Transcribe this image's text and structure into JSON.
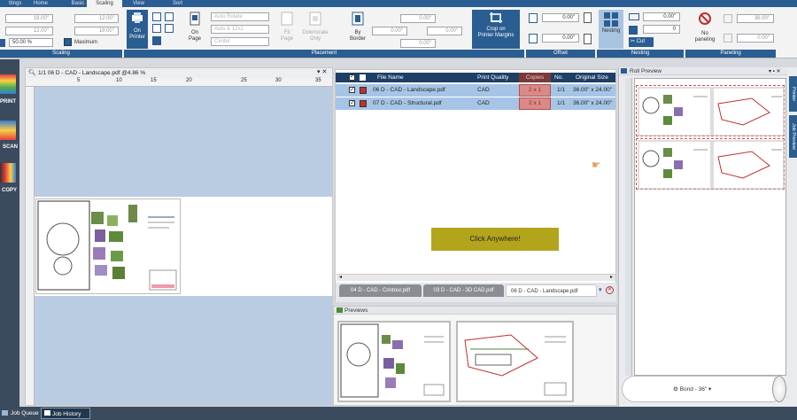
{
  "ribbon_tabs": [
    "ttings",
    "Home",
    "Basic",
    "Scaling",
    "View",
    "Sort"
  ],
  "scaling": {
    "spin1": "18.00\"",
    "spin2": "12.00\"",
    "spin3": "12.00\"",
    "spin4": "18.00\"",
    "percent": "50.00 %",
    "maximum_label": "Maximum",
    "group_title": "Scaling"
  },
  "placement": {
    "on_printer": "On\nPrinter",
    "on_page": "On\nPage",
    "fit_page": "Fit\nPage",
    "downscale_only": "Downscale\nOnly",
    "by_border": "By\nBorder",
    "auto_rotate": "Auto Rotate",
    "auto_12x1": "Auto & 12x1",
    "center": "Center",
    "spin_a": "0.00\"",
    "spin_b": "0.00\"",
    "spin_c": "0.00\"",
    "crop": "Crop on\nPrinter Margins",
    "group_title": "Placement"
  },
  "offset": {
    "x": "0.00\"",
    "y": "0.00\"",
    "group_title": "Offset"
  },
  "nesting": {
    "nesting_btn": "Nesting",
    "value1": "0.00\"",
    "value2": "0",
    "cut": "Cut",
    "group_title": "Nesting"
  },
  "paneling": {
    "no_paneling": "No\npaneling",
    "v1": "36.00\"",
    "v2": "0.00\"",
    "group_title": "Paneling"
  },
  "left_strip": [
    "PRINT",
    "SCAN",
    "COPY"
  ],
  "doc_preview": {
    "title": "1/1  06 D - CAD - Landscape.pdf  @4.86 %",
    "ruler_ticks": [
      "5",
      "10",
      "15",
      "20",
      "25",
      "30",
      "35"
    ]
  },
  "file_table": {
    "headers": [
      "File Name",
      "Print Quality",
      "Copies",
      "No.",
      "Original Size"
    ],
    "rows": [
      {
        "name": "06 D - CAD - Landscape.pdf",
        "quality": "CAD",
        "copies": "2 x 1",
        "no": "1/1",
        "size": "36.00\" x 24.00\""
      },
      {
        "name": "07 D - CAD - Structural.pdf",
        "quality": "CAD",
        "copies": "2 x 1",
        "no": "1/1",
        "size": "36.00\" x 24.00\""
      }
    ]
  },
  "click_anywhere": "Click Anywhere!",
  "file_tabs": [
    "04 D - CAD - Contour.pdf",
    "03 D - CAD - 3D CAD.pdf",
    "06 D - CAD - Landscape.pdf"
  ],
  "previews_title": "Previews",
  "roll_preview_title": "Roll Preview",
  "side_tabs": [
    "Printer",
    "Job Preview"
  ],
  "media": "Bond - 36\"",
  "footer_tabs": [
    "Job Queue",
    "Job History"
  ],
  "colors": {
    "accent": "#2a5d91",
    "header_dark": "#1e3f66",
    "highlight": "#b3a51b",
    "row_select": "#a6c5e6"
  }
}
